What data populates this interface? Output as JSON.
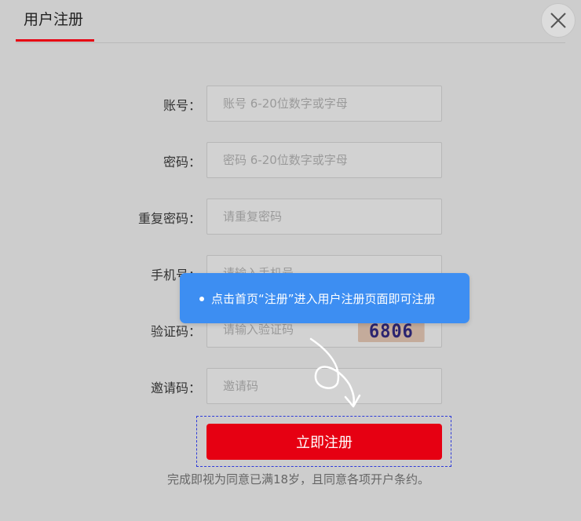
{
  "header": {
    "title": "用户注册"
  },
  "close": {
    "icon": "close-icon"
  },
  "form": {
    "account": {
      "label": "账号：",
      "placeholder": "账号 6-20位数字或字母"
    },
    "password": {
      "label": "密码：",
      "placeholder": "密码 6-20位数字或字母"
    },
    "repeat_password": {
      "label": "重复密码：",
      "placeholder": "请重复密码"
    },
    "phone": {
      "label": "手机号：",
      "placeholder": "请输入手机号"
    },
    "captcha": {
      "label": "验证码：",
      "placeholder": "请输入验证码",
      "code": "6806"
    },
    "invite": {
      "label": "邀请码：",
      "placeholder": "邀请码"
    }
  },
  "submit_label": "立即注册",
  "agreement": "完成即视为同意已满18岁，且同意各项开户条约。",
  "tooltip": {
    "text": "点击首页“注册”进入用户注册页面即可注册"
  },
  "colors": {
    "accent": "#e60012",
    "tooltip": "#3d8ef2",
    "background": "#cdcdcd"
  }
}
